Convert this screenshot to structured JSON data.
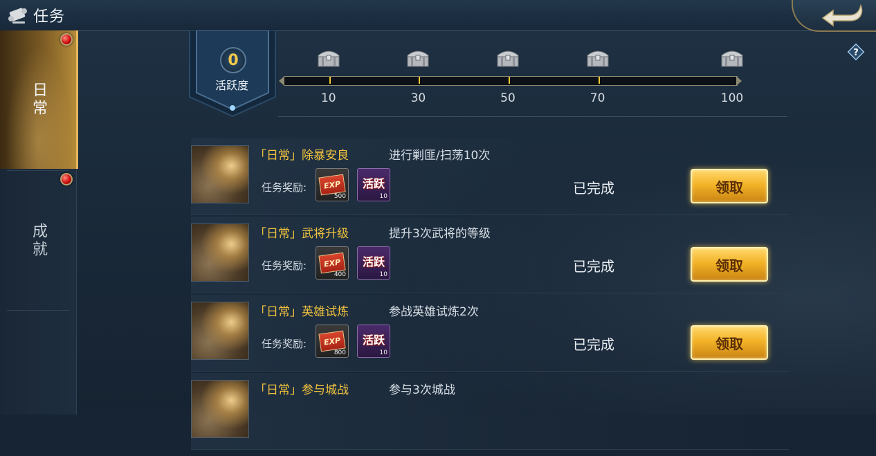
{
  "header": {
    "title": "任务",
    "scroll_icon": "scroll-icon",
    "back_icon": "back-arrow-icon"
  },
  "sidebar": {
    "tabs": [
      {
        "label": "日常",
        "active": true,
        "badge": true
      },
      {
        "label": "成就",
        "active": false,
        "badge": true
      }
    ]
  },
  "activity": {
    "value": "0",
    "label": "活跃度",
    "max": 100,
    "current_fraction": 0,
    "milestones": [
      "10",
      "30",
      "50",
      "70",
      "100"
    ],
    "chest_icon": "treasure-chest-icon"
  },
  "help": {
    "icon": "help-icon",
    "text": "?"
  },
  "reward_prefix": "任务奖励:",
  "tasks": [
    {
      "name": "「日常」除暴安良",
      "desc": "进行剿匪/扫荡10次",
      "exp_label": "EXP",
      "exp_count": "500",
      "huo_label": "活跃",
      "huo_count": "10",
      "status": "已完成",
      "button": "领取"
    },
    {
      "name": "「日常」武将升级",
      "desc": "提升3次武将的等级",
      "exp_label": "EXP",
      "exp_count": "400",
      "huo_label": "活跃",
      "huo_count": "10",
      "status": "已完成",
      "button": "领取"
    },
    {
      "name": "「日常」英雄试炼",
      "desc": "参战英雄试炼2次",
      "exp_label": "EXP",
      "exp_count": "800",
      "huo_label": "活跃",
      "huo_count": "10",
      "status": "已完成",
      "button": "领取"
    },
    {
      "name": "「日常」参与城战",
      "desc": "参与3次城战"
    }
  ],
  "colors": {
    "accent_gold": "#f2c33e",
    "button_gold": "#f3b328",
    "badge_red": "#d01010"
  }
}
